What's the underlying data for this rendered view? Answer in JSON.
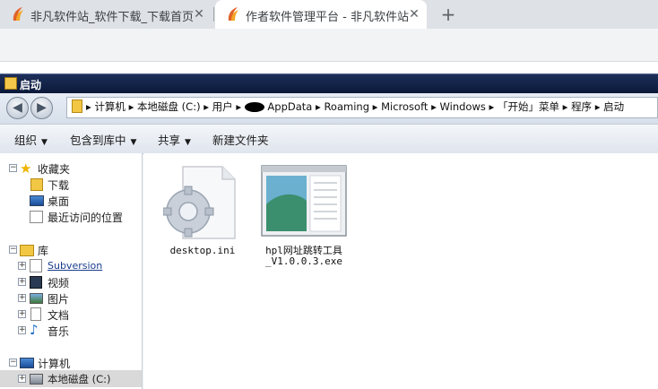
{
  "browser": {
    "tabs": [
      {
        "title": "非凡软件站_软件下载_下载首页",
        "close": "✕",
        "active": false
      },
      {
        "title": "作者软件管理平台 - 非凡软件站",
        "close": "✕",
        "active": true
      }
    ],
    "new_tab": "+"
  },
  "window": {
    "title": "启动",
    "nav": {
      "back": "◀",
      "forward": "▶"
    },
    "breadcrumbs": [
      "计算机",
      "本地磁盘 (C:)",
      "用户",
      "AppData",
      "Roaming",
      "Microsoft",
      "Windows",
      "「开始」菜单",
      "程序",
      "启动"
    ],
    "breadcrumb_sep": "▸",
    "commands": [
      {
        "label": "组织",
        "arrow": "▼"
      },
      {
        "label": "包含到库中",
        "arrow": "▼"
      },
      {
        "label": "共享",
        "arrow": "▼"
      },
      {
        "label": "新建文件夹",
        "arrow": ""
      }
    ],
    "tree": {
      "favorites": {
        "label": "收藏夹",
        "items": [
          "下载",
          "桌面",
          "最近访问的位置"
        ]
      },
      "libraries": {
        "label": "库",
        "items": [
          "Subversion",
          "视频",
          "图片",
          "文档",
          "音乐"
        ]
      },
      "computer": {
        "label": "计算机",
        "items": [
          "本地磁盘 (C:)"
        ]
      },
      "expander_open": "−",
      "expander_closed": "+"
    },
    "files": [
      {
        "name": "desktop.ini",
        "icon": "settings-file-icon"
      },
      {
        "name": "hpl网址跳转工具_V1.0.0.3.exe",
        "icon": "app-window-icon"
      }
    ]
  },
  "colors": {
    "tabstrip": "#dee1e6",
    "titlebar": "#0a1838",
    "selection": "#d9d9d9"
  }
}
